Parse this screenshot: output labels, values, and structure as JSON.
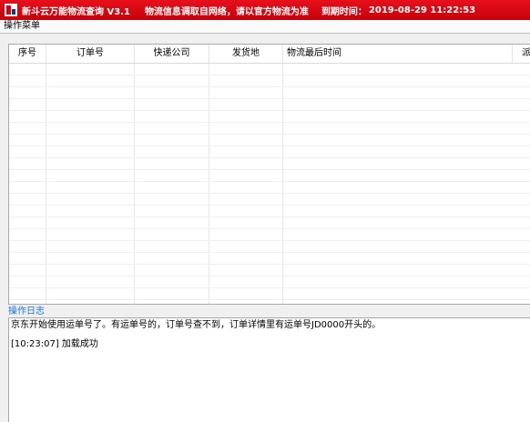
{
  "window": {
    "title": "新斗云万能物流查询 V3.1",
    "notice": "物流信息调取自网络，请以官方物流为准",
    "expire_label": "到期时间：",
    "expire_value": "2019-08-29 11:22:53",
    "icon": "app-logo-icon",
    "title_bar_color": "#d8000f"
  },
  "menu": {
    "items": [
      {
        "label": "操作菜单"
      }
    ]
  },
  "grid": {
    "columns": [
      "序号",
      "订单号",
      "快递公司",
      "发货地",
      "物流最后时间",
      "派送"
    ],
    "rows": []
  },
  "log": {
    "label": "操作日志",
    "label_color": "#1a73d9",
    "lines": [
      "京东开始使用运单号了。有运单号的，订单号查不到，订单详情里有运单号JD0000开头的。",
      "[10:23:07] 加载成功"
    ]
  }
}
